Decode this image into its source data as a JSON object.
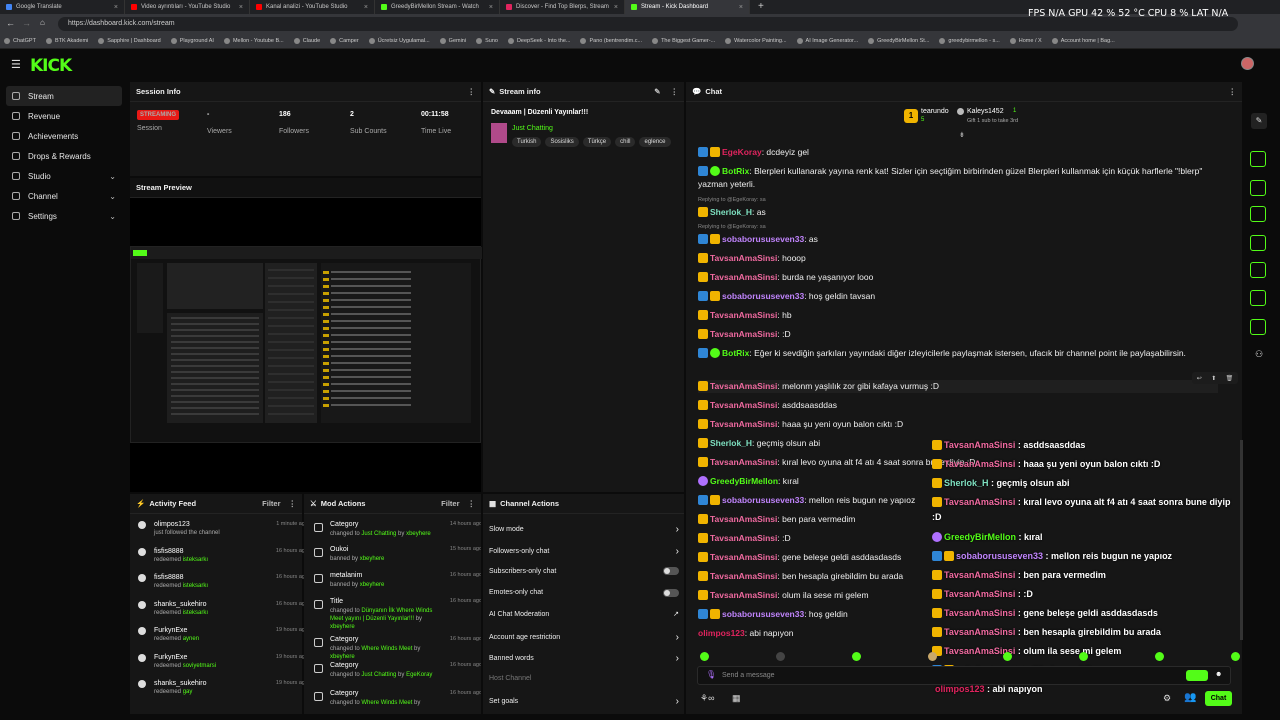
{
  "browser": {
    "tabs": [
      {
        "label": "Google Translate",
        "color": "#4285f4"
      },
      {
        "label": "Video ayrıntıları - YouTube Studio",
        "color": "#ff0000"
      },
      {
        "label": "Kanal analizi - YouTube Studio",
        "color": "#ff0000"
      },
      {
        "label": "GreedyBirMellon Stream - Watch",
        "color": "#53fc18"
      },
      {
        "label": "Discover - Find Top Blerps, Stream",
        "color": "#e0245e"
      },
      {
        "label": "Stream - Kick Dashboard",
        "color": "#53fc18"
      }
    ],
    "url": "https://dashboard.kick.com/stream",
    "bookmarks": [
      "ChatGPT",
      "BTK Akademi",
      "Sapphire | Dashboard",
      "Playground AI",
      "Mellon - Youtube B...",
      "Claude",
      "Camper",
      "Ücretsiz Uygulamal...",
      "Gemini",
      "Suno",
      "DeepSeek - Into the...",
      "Pano (bentrendim.c...",
      "The Biggest Gamer-...",
      "Watercolor Painting...",
      "AI Image Generator...",
      "GreedyBirMellon St...",
      "greedybirmellon - s...",
      "Home / X",
      "Account home | Bag..."
    ],
    "hud": "FPS N/A    GPU 42 % 52 °C    CPU 8 %    LAT N/A"
  },
  "kick": {
    "logo": "KICK"
  },
  "sidebar": {
    "items": [
      {
        "label": "Stream"
      },
      {
        "label": "Revenue"
      },
      {
        "label": "Achievements"
      },
      {
        "label": "Drops & Rewards"
      },
      {
        "label": "Studio"
      },
      {
        "label": "Channel"
      },
      {
        "label": "Settings"
      }
    ]
  },
  "session": {
    "title": "Session Info",
    "status": "STREAMING",
    "status_label": "Session",
    "viewers": "-",
    "viewers_label": "Viewers",
    "followers": "186",
    "followers_label": "Followers",
    "subs": "2",
    "subs_label": "Sub Counts",
    "time": "00:11:58",
    "time_label": "Time Live"
  },
  "preview": {
    "title": "Stream Preview"
  },
  "stream_info": {
    "title": "Stream info",
    "stream_title": "Devaaam | Düzenli Yayınlar!!!",
    "category": "Just Chatting",
    "tags": [
      "Turkish",
      "Sosisliks",
      "Türkçe",
      "chill",
      "eglence"
    ]
  },
  "activity": {
    "title": "Activity Feed",
    "filter": "Filter",
    "items": [
      {
        "name": "olimpos123",
        "sub": "just followed the channel",
        "time": "1 minute ago"
      },
      {
        "name": "fisfis8888",
        "sub_pre": "redeemed ",
        "sub_hl": "isteksarkı",
        "time": "16 hours ago"
      },
      {
        "name": "fisfis8888",
        "sub_pre": "redeemed ",
        "sub_hl": "isteksarkı",
        "time": "16 hours ago"
      },
      {
        "name": "shanks_sukehiro",
        "sub_pre": "redeemed ",
        "sub_hl": "isteksarkı",
        "time": "16 hours ago"
      },
      {
        "name": "FurkynExe",
        "sub_pre": "redeemed ",
        "sub_hl": "aynen",
        "time": "19 hours ago"
      },
      {
        "name": "FurkynExe",
        "sub_pre": "redeemed ",
        "sub_hl": "soviyetmarsi",
        "time": "19 hours ago"
      },
      {
        "name": "shanks_sukehiro",
        "sub_pre": "redeemed ",
        "sub_hl": "gay",
        "time": "19 hours ago"
      }
    ]
  },
  "mod": {
    "title": "Mod Actions",
    "filter": "Filter",
    "items": [
      {
        "name": "Category",
        "l2a": "changed to ",
        "l2b": "Just Chatting",
        "l2c": " by ",
        "l2d": "xbeyhere",
        "time": "14 hours ago"
      },
      {
        "name": "Oukoi",
        "l2a": "banned by ",
        "l2b": "",
        "l2c": "",
        "l2d": "xbeyhere",
        "time": "15 hours ago"
      },
      {
        "name": "metalanim",
        "l2a": "banned by ",
        "l2b": "",
        "l2c": "",
        "l2d": "xbeyhere",
        "time": "16 hours ago"
      },
      {
        "name": "Title",
        "l2a": "changed to ",
        "l2b": "Dünyanın İlk Where Winds Meet yayını | Düzenli Yayınlar!!!",
        "l2c": " by ",
        "l2d": "xbeyhere",
        "time": "16 hours ago"
      },
      {
        "name": "Category",
        "l2a": "changed to ",
        "l2b": "Where Winds Meet",
        "l2c": " by ",
        "l2d": "xbeyhere",
        "time": "16 hours ago"
      },
      {
        "name": "Category",
        "l2a": "changed to ",
        "l2b": "Just Chatting",
        "l2c": " by ",
        "l2d": "EgeKoray",
        "time": "16 hours ago"
      },
      {
        "name": "Category",
        "l2a": "changed to ",
        "l2b": "Where Winds Meet",
        "l2c": " by ",
        "l2d": "",
        "time": "16 hours ago"
      }
    ]
  },
  "channel_actions": {
    "title": "Channel Actions",
    "items": [
      "Slow mode",
      "Followers-only chat",
      "Subscribers-only chat",
      "Emotes-only chat",
      "AI Chat Moderation",
      "Account age restriction",
      "Banned words",
      "Host Channel",
      "Set goals"
    ]
  },
  "chat": {
    "title": "Chat",
    "top_user1": "tearundo",
    "top_user1_count": "5",
    "top_user2": "Kaleys1452",
    "top_user2_count": "1",
    "gift_note": "Gift 1 sub to take 3rd",
    "input_placeholder": "Send a message",
    "send_label": "Chat",
    "messages": [
      {
        "user": "EgeKoray",
        "color": "#e0245e",
        "badges": [
          "mod",
          "sub"
        ],
        "text": ": dcdeyiz gel"
      },
      {
        "user": "BotRix",
        "color": "#53fc18",
        "badges": [
          "mod",
          "bot"
        ],
        "text": ": Blerpleri kullanarak yayına renk kat! Sizler için seçtiğim birbirinden güzel Blerpleri kullanmak için küçük harflerle \"!blerp\" yazman yeterli."
      },
      {
        "reply": "Replying to @EgeKoray: sa"
      },
      {
        "user": "Sherlok_H",
        "color": "#7ee0c0",
        "badges": [
          "sub"
        ],
        "text": ": as"
      },
      {
        "reply": "Replying to @EgeKoray: sa"
      },
      {
        "user": "sobaborususeven33",
        "color": "#c084fc",
        "badges": [
          "mod",
          "sub"
        ],
        "text": ": as"
      },
      {
        "user": "TavsanAmaSinsi",
        "color": "#f06aa0",
        "badges": [
          "sub"
        ],
        "text": ": hooop"
      },
      {
        "user": "TavsanAmaSinsi",
        "color": "#f06aa0",
        "badges": [
          "sub"
        ],
        "text": ": burda ne yaşanıyor looo"
      },
      {
        "user": "sobaborususeven33",
        "color": "#c084fc",
        "badges": [
          "mod",
          "sub"
        ],
        "text": ": hoş geldin tavsan"
      },
      {
        "user": "TavsanAmaSinsi",
        "color": "#f06aa0",
        "badges": [
          "sub"
        ],
        "text": ": hb"
      },
      {
        "user": "TavsanAmaSinsi",
        "color": "#f06aa0",
        "badges": [
          "sub"
        ],
        "text": ": :D"
      },
      {
        "user": "BotRix",
        "color": "#53fc18",
        "badges": [
          "mod",
          "bot"
        ],
        "text": ": Eğer ki sevdiğin şarkıları yayındaki diğer izleyicilerle paylaşmak istersen, ufacık bir channel point ile paylaşabilirsin."
      },
      {
        "user": "TavsanAmaSinsi",
        "color": "#f06aa0",
        "badges": [
          "sub"
        ],
        "text": ": melonm yaşlılık zor gibi kafaya vurmuş :D"
      },
      {
        "user": "TavsanAmaSinsi",
        "color": "#f06aa0",
        "badges": [
          "sub"
        ],
        "text": ": asddsaasddas"
      },
      {
        "user": "TavsanAmaSinsi",
        "color": "#f06aa0",
        "badges": [
          "sub"
        ],
        "text": ": haaa şu yeni oyun balon cıktı :D"
      },
      {
        "user": "Sherlok_H",
        "color": "#7ee0c0",
        "badges": [
          "sub"
        ],
        "text": ": geçmiş olsun abi"
      },
      {
        "user": "TavsanAmaSinsi",
        "color": "#f06aa0",
        "badges": [
          "sub"
        ],
        "text": ": kıral levo oyuna alt f4 atı 4 saat sonra bune diyip :D"
      },
      {
        "user": "GreedyBirMellon",
        "color": "#53fc18",
        "badges": [
          "host"
        ],
        "text": ": kıral"
      },
      {
        "user": "sobaborususeven33",
        "color": "#c084fc",
        "badges": [
          "mod",
          "sub"
        ],
        "text": ": mellon reis bugun ne yapıoz"
      },
      {
        "user": "TavsanAmaSinsi",
        "color": "#f06aa0",
        "badges": [
          "sub"
        ],
        "text": ": ben para vermedim"
      },
      {
        "user": "TavsanAmaSinsi",
        "color": "#f06aa0",
        "badges": [
          "sub"
        ],
        "text": ": :D"
      },
      {
        "user": "TavsanAmaSinsi",
        "color": "#f06aa0",
        "badges": [
          "sub"
        ],
        "text": ": gene beleşe geldi asddasdasds"
      },
      {
        "user": "TavsanAmaSinsi",
        "color": "#f06aa0",
        "badges": [
          "sub"
        ],
        "text": ": ben hesapla girebildim bu arada"
      },
      {
        "user": "TavsanAmaSinsi",
        "color": "#f06aa0",
        "badges": [
          "sub"
        ],
        "text": ": olum ila sese mi gelem"
      },
      {
        "user": "sobaborususeven33",
        "color": "#c084fc",
        "badges": [
          "mod",
          "sub"
        ],
        "text": ": hoş geldin"
      },
      {
        "user": "olimpos123",
        "color": "#e0245e",
        "badges": [],
        "text": ": abi napıyon"
      }
    ],
    "overlay": [
      {
        "user": "TavsanAmaSinsi",
        "color": "#f06aa0",
        "badges": [
          "sub"
        ],
        "text": " : asddsaasddas"
      },
      {
        "user": "TavsanAmaSinsi",
        "color": "#f06aa0",
        "badges": [
          "sub"
        ],
        "text": " : haaa şu yeni oyun balon cıktı :D"
      },
      {
        "user": "Sherlok_H",
        "color": "#7ee0c0",
        "badges": [
          "sub"
        ],
        "text": " : geçmiş olsun abi"
      },
      {
        "user": "TavsanAmaSinsi",
        "color": "#f06aa0",
        "badges": [
          "sub"
        ],
        "text": " : kıral levo oyuna alt f4 atı 4 saat sonra bune diyip"
      },
      {
        "user": "",
        "color": "#fff",
        "badges": [],
        "text": ":D"
      },
      {
        "user": "GreedyBirMellon",
        "color": "#53fc18",
        "badges": [
          "host"
        ],
        "text": " : kıral"
      },
      {
        "user": "sobaborususeven33",
        "color": "#c084fc",
        "badges": [
          "mod",
          "sub"
        ],
        "text": " : mellon reis bugun ne yapıoz"
      },
      {
        "user": "TavsanAmaSinsi",
        "color": "#f06aa0",
        "badges": [
          "sub"
        ],
        "text": " : ben para vermedim"
      },
      {
        "user": "TavsanAmaSinsi",
        "color": "#f06aa0",
        "badges": [
          "sub"
        ],
        "text": " : :D"
      },
      {
        "user": "TavsanAmaSinsi",
        "color": "#f06aa0",
        "badges": [
          "sub"
        ],
        "text": " : gene beleşe geldi asddasdasds"
      },
      {
        "user": "TavsanAmaSinsi",
        "color": "#f06aa0",
        "badges": [
          "sub"
        ],
        "text": " : ben hesapla girebildim bu arada"
      },
      {
        "user": "TavsanAmaSinsi",
        "color": "#f06aa0",
        "badges": [
          "sub"
        ],
        "text": " : olum ila sese mi gelem"
      },
      {
        "user": "sobaborususeven33",
        "color": "#c084fc",
        "badges": [
          "mod",
          "sub"
        ],
        "text": " : hoş geldin"
      },
      {
        "user": "olimpos123",
        "color": "#e0245e",
        "badges": [],
        "text": " : abi napıyon"
      }
    ]
  },
  "colors": {
    "accent": "#53fc18",
    "live": "#e91916",
    "panel": "#161616"
  }
}
